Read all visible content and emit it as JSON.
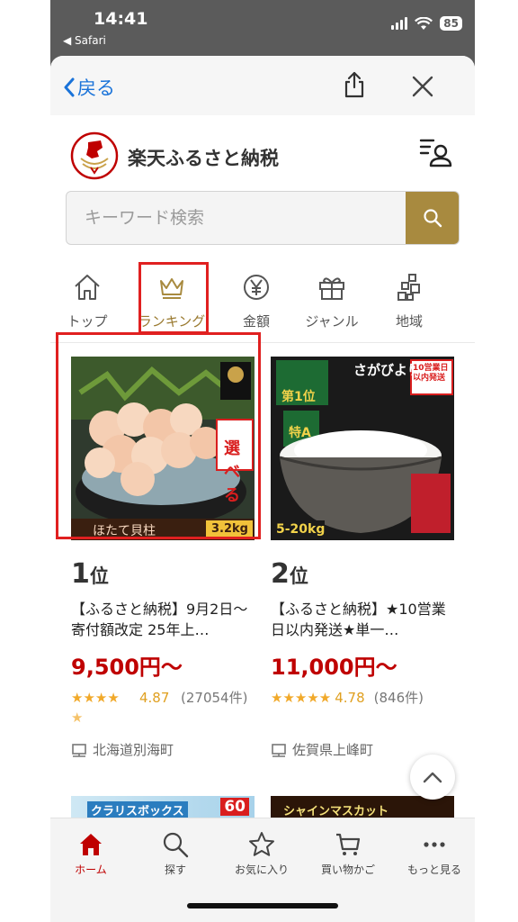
{
  "status_bar": {
    "time": "14:41",
    "back_app": "◀ Safari",
    "battery": "85"
  },
  "browser_nav": {
    "back_label": "戻る"
  },
  "header": {
    "brand": "楽天ふるさと納税"
  },
  "search": {
    "placeholder": "キーワード検索"
  },
  "categories": [
    {
      "label": "トップ",
      "icon": "home-icon"
    },
    {
      "label": "ランキング",
      "icon": "crown-icon",
      "active": true
    },
    {
      "label": "金額",
      "icon": "yen-icon"
    },
    {
      "label": "ジャンル",
      "icon": "gift-icon"
    },
    {
      "label": "地域",
      "icon": "map-icon"
    }
  ],
  "products": [
    {
      "rank_num": "1",
      "rank_suffix": "位",
      "title": "【ふるさと納税】9月2日〜寄付額改定 25年上…",
      "price": "9,500円〜",
      "stars": "★★★★",
      "stars_half": "★",
      "score": "4.87",
      "reviews": "(27054件)",
      "location": "北海道別海町",
      "image_labels": [
        "ほたて貝柱",
        "選べる",
        "3.2kg"
      ]
    },
    {
      "rank_num": "2",
      "rank_suffix": "位",
      "title": "【ふるさと納税】★10営業日以内発送★単一…",
      "price": "11,000円〜",
      "stars": "★★★★★",
      "score": "4.78",
      "reviews": "(846件)",
      "location": "佐賀県上峰町",
      "image_labels": [
        "さがびより",
        "第1位",
        "特A",
        "10営業日以内発送",
        "5-20kg"
      ]
    }
  ],
  "next_items": [
    {
      "label": "クラリスボックス",
      "badge": "60"
    },
    {
      "label": "シャインマスカット"
    }
  ],
  "tabbar": [
    {
      "label": "ホーム",
      "icon": "home-icon",
      "active": true
    },
    {
      "label": "探す",
      "icon": "search-icon"
    },
    {
      "label": "お気に入り",
      "icon": "star-icon"
    },
    {
      "label": "買い物かご",
      "icon": "cart-icon"
    },
    {
      "label": "もっと見る",
      "icon": "more-icon"
    }
  ],
  "colors": {
    "brand_gold": "#a88a3f",
    "price_red": "#bf0000",
    "link_blue": "#1a73d9",
    "highlight_red": "#e02020"
  }
}
